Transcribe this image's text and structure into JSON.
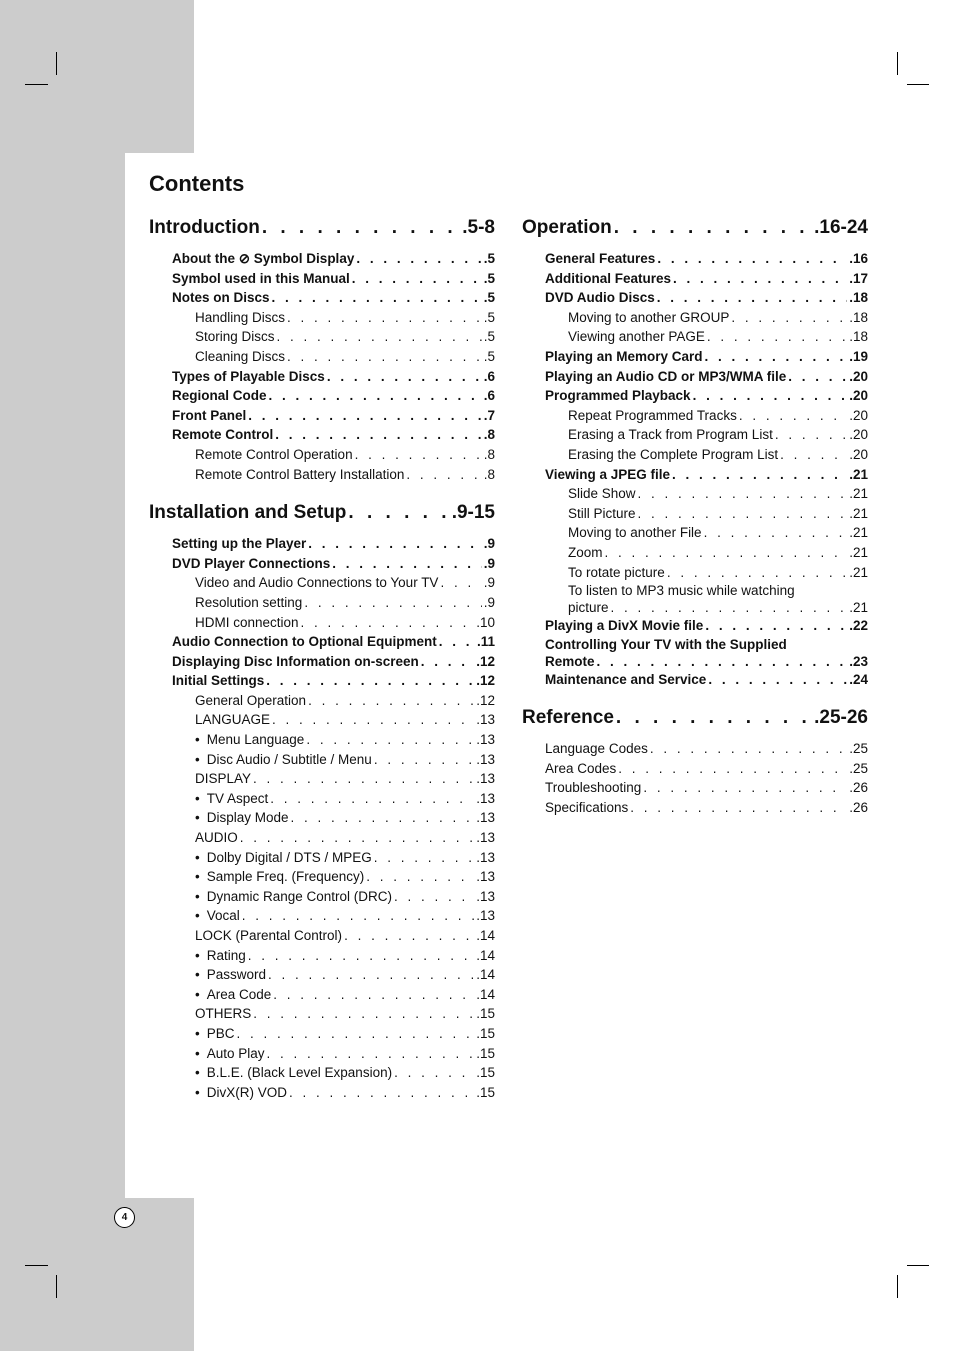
{
  "page_title": "Contents",
  "page_number": "4",
  "left_column": [
    {
      "title": "Introduction",
      "pages": ".5-8",
      "items": [
        {
          "label": "About the ⊘ Symbol Display",
          "page": ".5",
          "level": 1
        },
        {
          "label": "Symbol used in this Manual",
          "page": ".5",
          "level": 1
        },
        {
          "label": "Notes on Discs",
          "page": ".5",
          "level": 1
        },
        {
          "label": "Handling Discs",
          "page": ".5",
          "level": 2
        },
        {
          "label": "Storing Discs",
          "page": ".5",
          "level": 2
        },
        {
          "label": "Cleaning Discs",
          "page": ".5",
          "level": 2
        },
        {
          "label": "Types of Playable Discs",
          "page": ".6",
          "level": 1
        },
        {
          "label": "Regional Code",
          "page": ".6",
          "level": 1
        },
        {
          "label": "Front Panel",
          "page": ".7",
          "level": 1
        },
        {
          "label": "Remote Control",
          "page": ".8",
          "level": 1
        },
        {
          "label": "Remote Control Operation",
          "page": ".8",
          "level": 2
        },
        {
          "label": "Remote Control Battery Installation",
          "page": ".8",
          "level": 2
        }
      ]
    },
    {
      "title": "Installation and Setup",
      "pages": ".9-15",
      "items": [
        {
          "label": "Setting up the Player",
          "page": ".9",
          "level": 1
        },
        {
          "label": "DVD Player Connections",
          "page": ".9",
          "level": 1
        },
        {
          "label": "Video and Audio Connections to Your TV",
          "page": ".9",
          "level": 2
        },
        {
          "label": "Resolution setting",
          "page": ".9",
          "level": 2
        },
        {
          "label": "HDMI connection",
          "page": ".10",
          "level": 2
        },
        {
          "label": "Audio Connection to Optional Equipment",
          "page": ".11",
          "level": 1
        },
        {
          "label": "Displaying Disc Information on-screen",
          "page": ".12",
          "level": 1
        },
        {
          "label": "Initial Settings",
          "page": ".12",
          "level": 1
        },
        {
          "label": "General Operation",
          "page": ".12",
          "level": 2
        },
        {
          "label": "LANGUAGE",
          "page": ".13",
          "level": 2
        },
        {
          "label": "Menu Language",
          "page": ".13",
          "level": 2,
          "bullet": true
        },
        {
          "label": "Disc Audio / Subtitle / Menu",
          "page": ".13",
          "level": 2,
          "bullet": true
        },
        {
          "label": "DISPLAY",
          "page": ".13",
          "level": 2
        },
        {
          "label": "TV Aspect",
          "page": ".13",
          "level": 2,
          "bullet": true
        },
        {
          "label": "Display Mode",
          "page": ".13",
          "level": 2,
          "bullet": true
        },
        {
          "label": "AUDIO",
          "page": ".13",
          "level": 2
        },
        {
          "label": "Dolby Digital / DTS / MPEG",
          "page": ".13",
          "level": 2,
          "bullet": true
        },
        {
          "label": "Sample Freq. (Frequency)",
          "page": ".13",
          "level": 2,
          "bullet": true
        },
        {
          "label": "Dynamic Range Control (DRC)",
          "page": ".13",
          "level": 2,
          "bullet": true
        },
        {
          "label": "Vocal",
          "page": ".13",
          "level": 2,
          "bullet": true
        },
        {
          "label": "LOCK (Parental Control)",
          "page": ".14",
          "level": 2
        },
        {
          "label": "Rating",
          "page": ".14",
          "level": 2,
          "bullet": true
        },
        {
          "label": "Password",
          "page": ".14",
          "level": 2,
          "bullet": true
        },
        {
          "label": "Area Code",
          "page": ".14",
          "level": 2,
          "bullet": true
        },
        {
          "label": "OTHERS",
          "page": ".15",
          "level": 2
        },
        {
          "label": "PBC",
          "page": ".15",
          "level": 2,
          "bullet": true
        },
        {
          "label": "Auto Play",
          "page": ".15",
          "level": 2,
          "bullet": true
        },
        {
          "label": "B.L.E. (Black Level Expansion)",
          "page": ".15",
          "level": 2,
          "bullet": true
        },
        {
          "label": "DivX(R) VOD",
          "page": ".15",
          "level": 2,
          "bullet": true
        }
      ]
    }
  ],
  "right_column": [
    {
      "title": "Operation",
      "pages": ".16-24",
      "items": [
        {
          "label": "General Features",
          "page": ".16",
          "level": 1
        },
        {
          "label": "Additional Features",
          "page": ".17",
          "level": 1
        },
        {
          "label": "DVD Audio Discs",
          "page": ".18",
          "level": 1
        },
        {
          "label": "Moving to another GROUP",
          "page": ".18",
          "level": 2
        },
        {
          "label": "Viewing another PAGE",
          "page": ".18",
          "level": 2
        },
        {
          "label": "Playing an Memory Card",
          "page": ".19",
          "level": 1
        },
        {
          "label": "Playing an Audio CD or MP3/WMA file",
          "page": ".20",
          "level": 1
        },
        {
          "label": "Programmed Playback",
          "page": ".20",
          "level": 1
        },
        {
          "label": "Repeat Programmed Tracks",
          "page": ".20",
          "level": 2
        },
        {
          "label": "Erasing a Track from Program List",
          "page": ".20",
          "level": 2
        },
        {
          "label": "Erasing the Complete Program List",
          "page": ".20",
          "level": 2
        },
        {
          "label": "Viewing a JPEG file",
          "page": ".21",
          "level": 1
        },
        {
          "label": "Slide Show",
          "page": ".21",
          "level": 2
        },
        {
          "label": "Still Picture",
          "page": ".21",
          "level": 2
        },
        {
          "label": "Moving to another File",
          "page": ".21",
          "level": 2
        },
        {
          "label": "Zoom",
          "page": ".21",
          "level": 2
        },
        {
          "label": "To rotate picture",
          "page": ".21",
          "level": 2
        },
        {
          "label_line1": "To listen to MP3 music while watching",
          "label": "picture",
          "page": ".21",
          "level": 2
        },
        {
          "label": "Playing a DivX Movie file",
          "page": ".22",
          "level": 1
        },
        {
          "label_line1": "Controlling Your TV with the Supplied",
          "label": "Remote",
          "page": ".23",
          "level": 1
        },
        {
          "label": "Maintenance and Service",
          "page": ".24",
          "level": 1
        }
      ]
    },
    {
      "title": "Reference",
      "pages": ".25-26",
      "items": [
        {
          "label": "Language Codes",
          "page": ".25",
          "level": 2,
          "ref": true
        },
        {
          "label": "Area Codes",
          "page": ".25",
          "level": 2,
          "ref": true
        },
        {
          "label": "Troubleshooting",
          "page": ".26",
          "level": 2,
          "ref": true
        },
        {
          "label": "Specifications",
          "page": ".26",
          "level": 2,
          "ref": true
        }
      ]
    }
  ]
}
